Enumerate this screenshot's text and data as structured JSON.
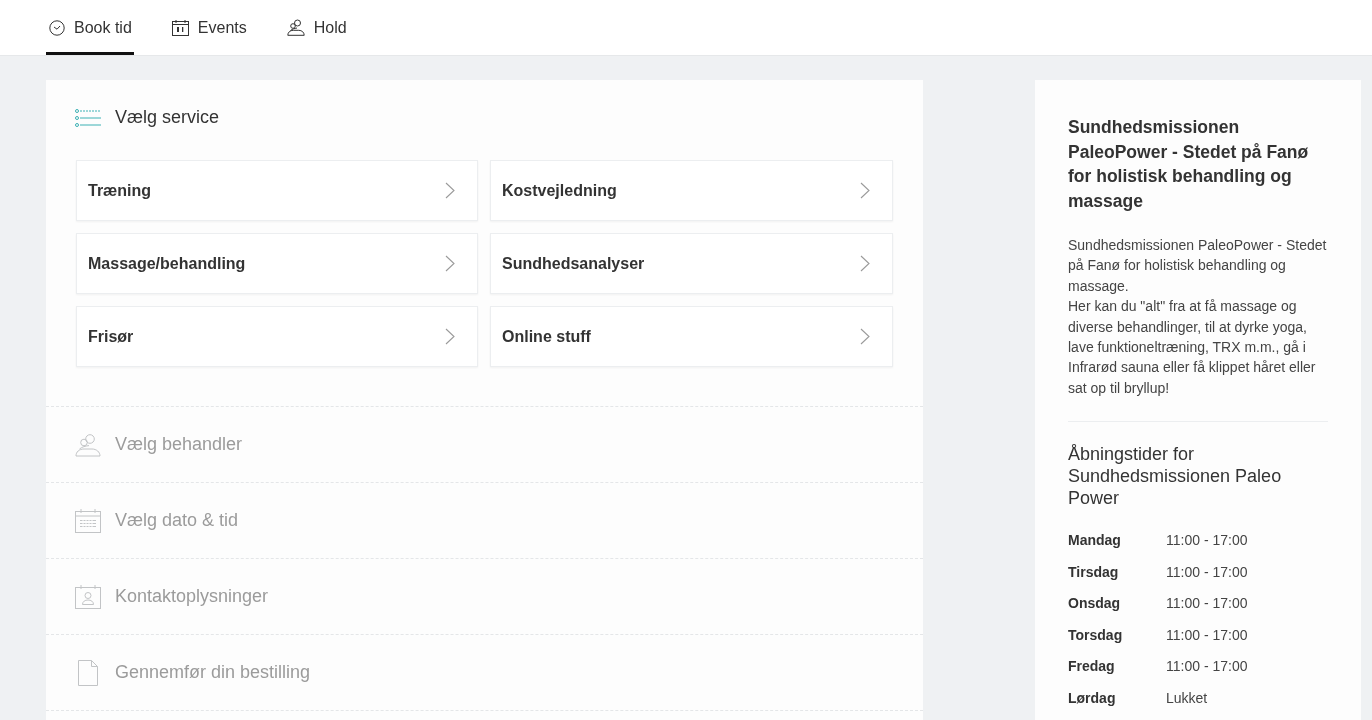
{
  "tabs": [
    {
      "label": "Book tid",
      "selected": true
    },
    {
      "label": "Events",
      "selected": false
    },
    {
      "label": "Hold",
      "selected": false
    }
  ],
  "steps": [
    {
      "title": "Vælg service",
      "active": true,
      "options": [
        "Træning",
        "Kostvejledning",
        "Massage/behandling",
        "Sundhedsanalyser",
        "Frisør",
        "Online stuff"
      ]
    },
    {
      "title": "Vælg behandler",
      "active": false
    },
    {
      "title": "Vælg dato & tid",
      "active": false
    },
    {
      "title": "Kontaktoplysninger",
      "active": false
    },
    {
      "title": "Gennemfør din bestilling",
      "active": false
    }
  ],
  "info": {
    "title": "Sundhedsmissionen PaleoPower - Stedet på Fanø for holistisk behandling og massage",
    "description": "Sundhedsmissionen PaleoPower - Stedet på Fanø for holistisk behandling og massage.\nHer kan du \"alt\" fra at få massage og diverse behandlinger, til at dyrke yoga, lave funktioneltræning, TRX m.m., gå i Infrarød sauna eller få klippet håret eller sat op til bryllup!",
    "hours_title": "Åbningstider for Sundhedsmissionen Paleo Power",
    "hours": [
      {
        "day": "Mandag",
        "time": "11:00 - 17:00"
      },
      {
        "day": "Tirsdag",
        "time": "11:00 - 17:00"
      },
      {
        "day": "Onsdag",
        "time": "11:00 - 17:00"
      },
      {
        "day": "Torsdag",
        "time": "11:00 - 17:00"
      },
      {
        "day": "Fredag",
        "time": "11:00 - 17:00"
      },
      {
        "day": "Lørdag",
        "time": "Lukket"
      }
    ]
  }
}
